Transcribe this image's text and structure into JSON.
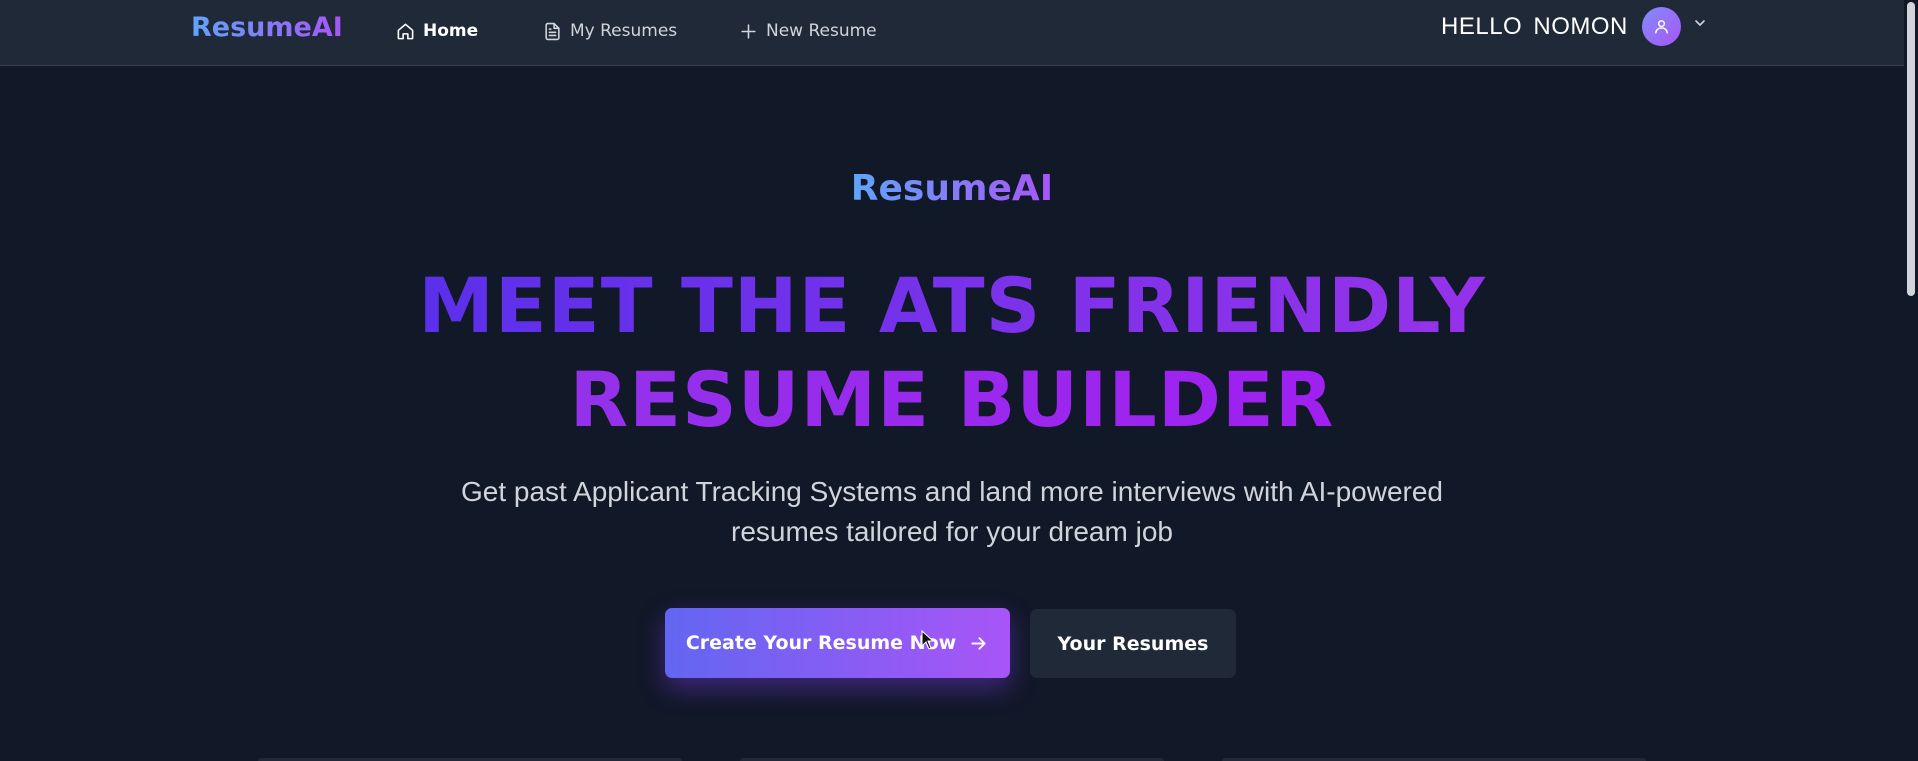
{
  "navbar": {
    "brand": "ResumeAI",
    "links": [
      {
        "label": "Home",
        "icon": "home-icon",
        "active": true
      },
      {
        "label": "My Resumes",
        "icon": "document-icon",
        "active": false
      },
      {
        "label": "New Resume",
        "icon": "plus-icon",
        "active": false
      }
    ],
    "greeting": "HELLO NOMON",
    "avatar_icon": "user-icon",
    "dropdown_icon": "chevron-down-icon"
  },
  "hero": {
    "brand": "ResumeAI",
    "headline": "MEET THE ATS FRIENDLY RESUME BUILDER",
    "subtitle": "Get past Applicant Tracking Systems and land more interviews with AI-powered resumes tailored for your dream job",
    "primary_button": {
      "label": "Create Your Resume Now",
      "icon": "arrow-right-icon"
    },
    "secondary_button": {
      "label": "Your Resumes"
    }
  },
  "colors": {
    "background": "#111827",
    "navbar": "#1f2937",
    "accent_start": "#6366f1",
    "accent_end": "#a855f7"
  }
}
